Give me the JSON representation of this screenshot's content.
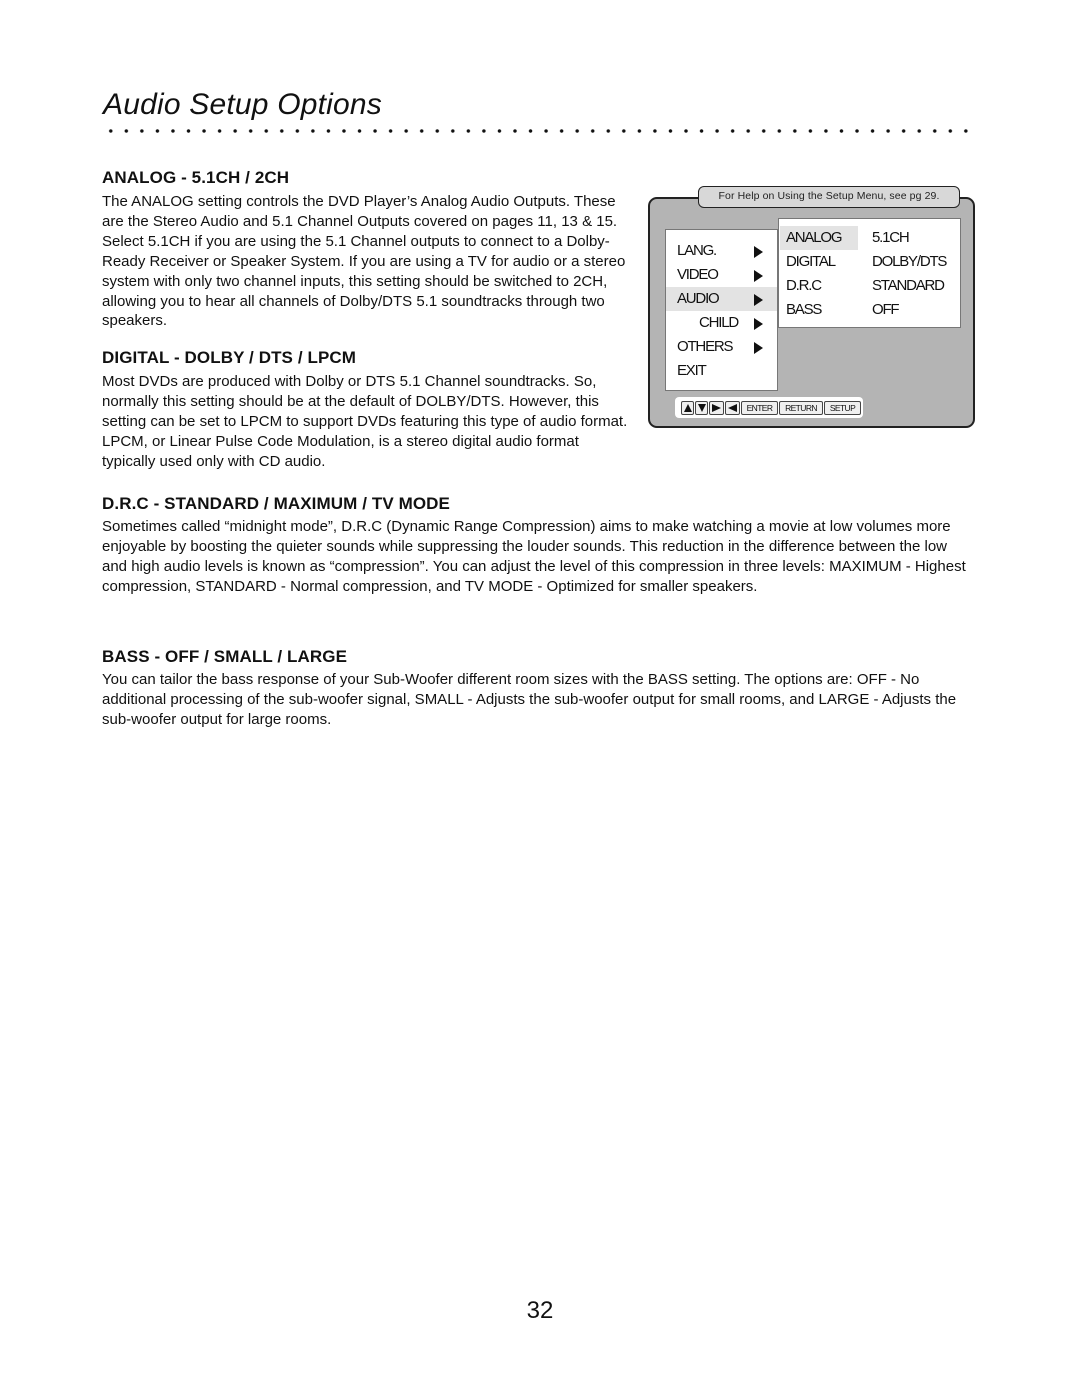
{
  "page": {
    "title": "Audio Setup Options",
    "page_number": "32"
  },
  "sections": [
    {
      "heading": "ANALOG - 5.1CH / 2CH",
      "body": "The ANALOG setting controls the DVD Player’s Analog Audio Outputs. These are the Stereo Audio and 5.1 Channel Outputs covered on pages 11, 13 & 15. Select 5.1CH if you are using the 5.1 Channel outputs to connect to a Dolby-Ready Receiver or Speaker System. If you are using a TV for audio or a stereo system with only two channel inputs, this setting should be switched to 2CH, allowing you to hear all channels of Dolby/DTS 5.1 soundtracks through two speakers."
    },
    {
      "heading": "DIGITAL - DOLBY / DTS / LPCM",
      "body": "Most DVDs are produced with Dolby or DTS 5.1 Channel soundtracks. So, normally this setting should be at the default of DOLBY/DTS. However, this setting can be set to LPCM to support DVDs featuring this type of audio format. LPCM, or Linear Pulse Code Modulation, is a stereo digital audio format typically used only with CD audio."
    },
    {
      "heading": "D.R.C - STANDARD / MAXIMUM / TV MODE",
      "body": "Sometimes called “midnight mode”, D.R.C (Dynamic Range Compression) aims to make watching a movie at low volumes more enjoyable by boosting the quieter sounds while suppressing the louder sounds. This reduction in the difference between the low and high audio levels is known as “compression”. You can adjust the level of this compression in three levels: MAXIMUM - Highest compression, STANDARD - Normal compression, and TV MODE - Optimized for smaller speakers."
    },
    {
      "heading": "BASS - OFF / SMALL / LARGE",
      "body": "You can tailor the bass response of your Sub-Woofer different room sizes with the BASS setting. The options are: OFF - No additional processing of the sub-woofer signal, SMALL - Adjusts the sub-woofer output for small rooms, and LARGE - Adjusts the sub-woofer output for large rooms."
    }
  ],
  "setup_menu": {
    "help_text": "For Help on Using the Setup Menu, see pg 29.",
    "main_items": [
      {
        "label": "LANG.",
        "has_arrow": true,
        "active": false
      },
      {
        "label": "VIDEO",
        "has_arrow": true,
        "active": false
      },
      {
        "label": "AUDIO",
        "has_arrow": true,
        "active": true
      },
      {
        "label": "CHILD",
        "has_arrow": true,
        "active": false
      },
      {
        "label": "OTHERS",
        "has_arrow": true,
        "active": false
      },
      {
        "label": "EXIT",
        "has_arrow": false,
        "active": false
      }
    ],
    "audio_settings": [
      {
        "name": "ANALOG",
        "value": "5.1CH",
        "active": true
      },
      {
        "name": "DIGITAL",
        "value": "DOLBY/DTS",
        "active": false
      },
      {
        "name": "D.R.C",
        "value": "STANDARD",
        "active": false
      },
      {
        "name": "BASS",
        "value": "OFF",
        "active": false
      }
    ],
    "keys": {
      "up": "up-arrow-icon",
      "down": "down-arrow-icon",
      "right": "right-arrow-icon",
      "left": "left-arrow-icon",
      "enter": "ENTER",
      "return": "RETURN",
      "setup": "SETUP"
    },
    "colors": {
      "panel": "#b4b4b4",
      "highlight": "#e3e3e3"
    }
  }
}
